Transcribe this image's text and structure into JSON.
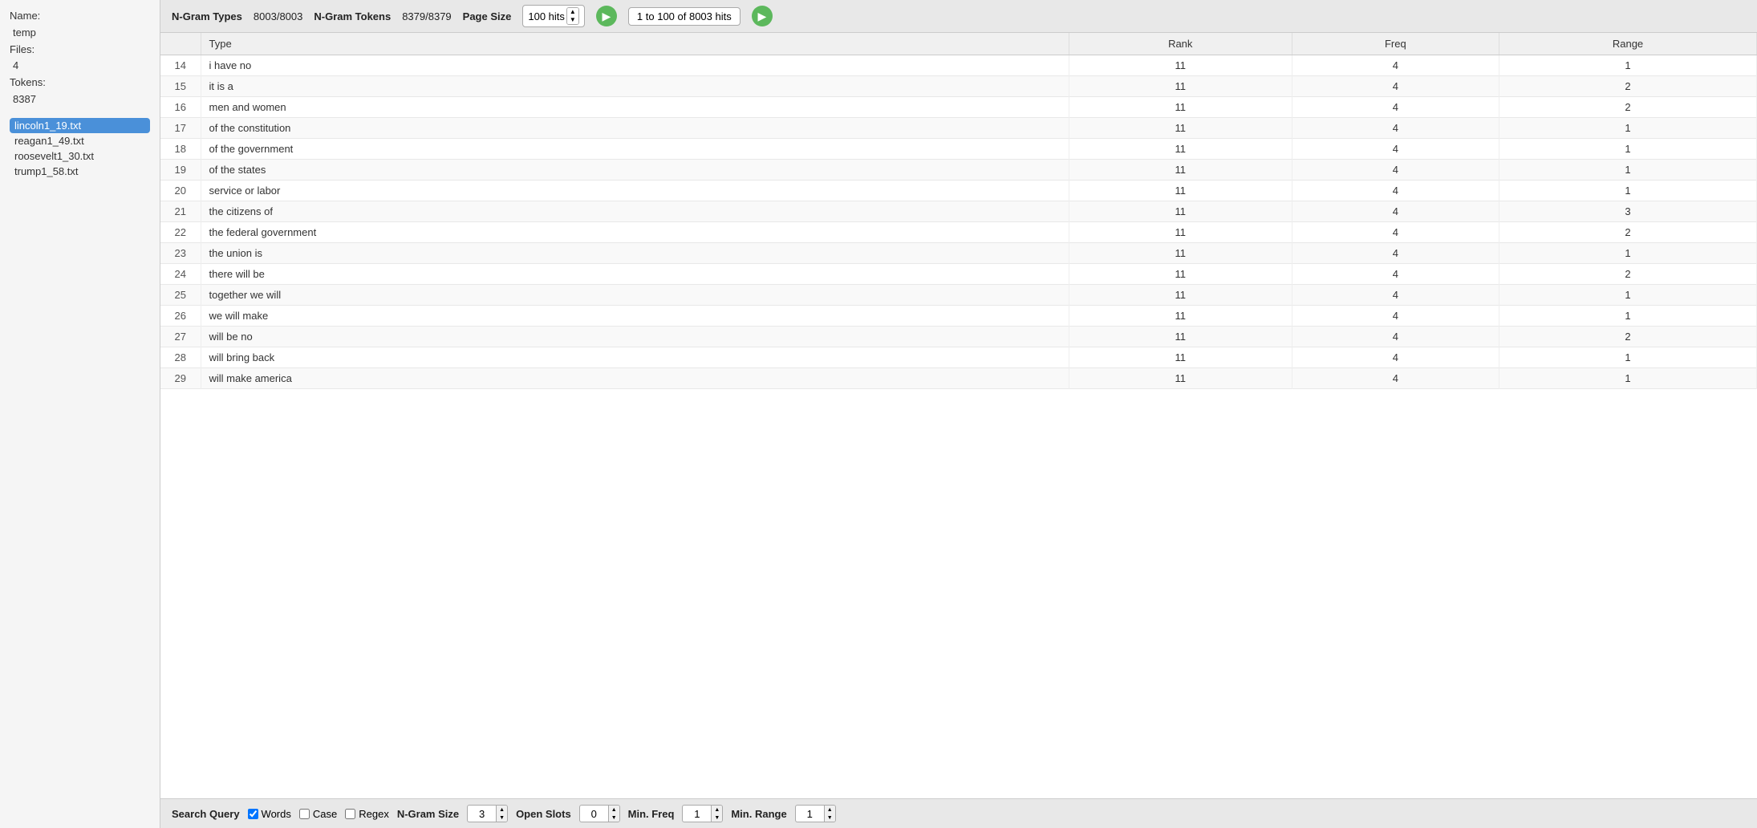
{
  "sidebar": {
    "name_label": "Name:",
    "name_value": "temp",
    "files_label": "Files:",
    "files_value": "4",
    "tokens_label": "Tokens:",
    "tokens_value": "8387",
    "files": [
      {
        "label": "lincoln1_19.txt",
        "selected": true
      },
      {
        "label": "reagan1_49.txt",
        "selected": false
      },
      {
        "label": "roosevelt1_30.txt",
        "selected": false
      },
      {
        "label": "trump1_58.txt",
        "selected": false
      }
    ]
  },
  "toolbar_top": {
    "ngram_types_label": "N-Gram Types",
    "ngram_types_value": "8003/8003",
    "ngram_tokens_label": "N-Gram Tokens",
    "ngram_tokens_value": "8379/8379",
    "page_size_label": "Page Size",
    "page_size_value": "100 hits",
    "pagination_info": "1 to 100 of 8003 hits"
  },
  "table": {
    "headers": [
      "",
      "Type",
      "Rank",
      "Freq",
      "Range"
    ],
    "rows": [
      {
        "num": 14,
        "type": "i have no",
        "rank": 11,
        "freq": 4,
        "range": 1
      },
      {
        "num": 15,
        "type": "it is a",
        "rank": 11,
        "freq": 4,
        "range": 2
      },
      {
        "num": 16,
        "type": "men and women",
        "rank": 11,
        "freq": 4,
        "range": 2
      },
      {
        "num": 17,
        "type": "of the constitution",
        "rank": 11,
        "freq": 4,
        "range": 1
      },
      {
        "num": 18,
        "type": "of the government",
        "rank": 11,
        "freq": 4,
        "range": 1
      },
      {
        "num": 19,
        "type": "of the states",
        "rank": 11,
        "freq": 4,
        "range": 1
      },
      {
        "num": 20,
        "type": "service or labor",
        "rank": 11,
        "freq": 4,
        "range": 1
      },
      {
        "num": 21,
        "type": "the citizens of",
        "rank": 11,
        "freq": 4,
        "range": 3
      },
      {
        "num": 22,
        "type": "the federal government",
        "rank": 11,
        "freq": 4,
        "range": 2
      },
      {
        "num": 23,
        "type": "the union is",
        "rank": 11,
        "freq": 4,
        "range": 1
      },
      {
        "num": 24,
        "type": "there will be",
        "rank": 11,
        "freq": 4,
        "range": 2
      },
      {
        "num": 25,
        "type": "together we will",
        "rank": 11,
        "freq": 4,
        "range": 1
      },
      {
        "num": 26,
        "type": "we will make",
        "rank": 11,
        "freq": 4,
        "range": 1
      },
      {
        "num": 27,
        "type": "will be no",
        "rank": 11,
        "freq": 4,
        "range": 2
      },
      {
        "num": 28,
        "type": "will bring back",
        "rank": 11,
        "freq": 4,
        "range": 1
      },
      {
        "num": 29,
        "type": "will make america",
        "rank": 11,
        "freq": 4,
        "range": 1
      }
    ]
  },
  "toolbar_bottom": {
    "search_query_label": "Search Query",
    "words_label": "Words",
    "case_label": "Case",
    "regex_label": "Regex",
    "ngram_size_label": "N-Gram Size",
    "ngram_size_value": "3",
    "open_slots_label": "Open Slots",
    "open_slots_value": "0",
    "min_freq_label": "Min. Freq",
    "min_freq_value": "1",
    "min_range_label": "Min. Range",
    "min_range_value": "1"
  }
}
